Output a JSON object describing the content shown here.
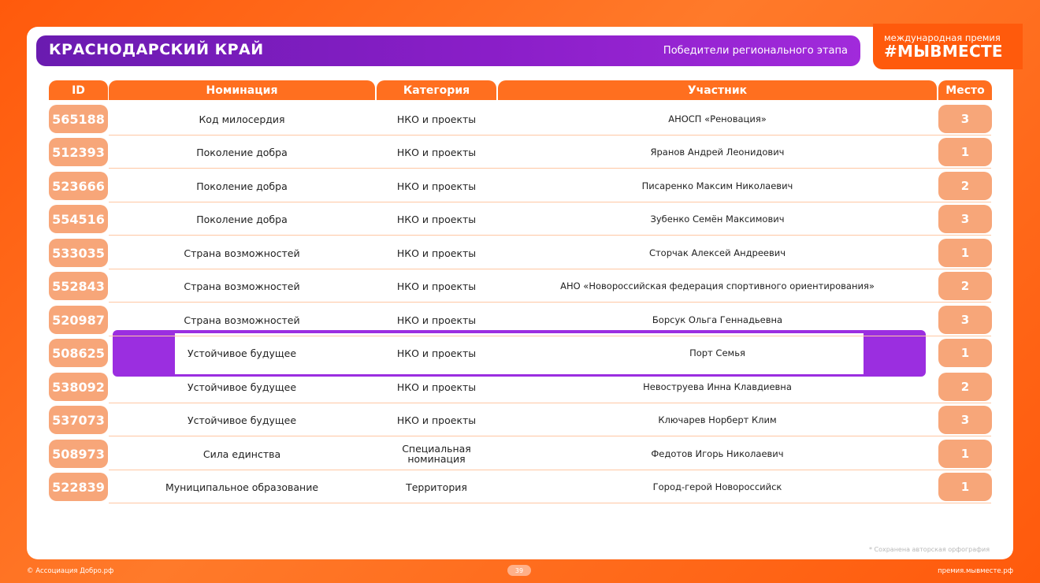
{
  "header": {
    "region": "КРАСНОДАРСКИЙ КРАЙ",
    "subtitle": "Победители регионального этапа",
    "award_small": "международная премия",
    "award_big": "#МЫВМЕСТЕ"
  },
  "columns": [
    "ID",
    "Номинация",
    "Категория",
    "Участник",
    "Место"
  ],
  "rows": [
    {
      "id": "565188",
      "nomination": "Код милосердия",
      "category": "НКО и проекты",
      "participant": "АНОСП «Реновация»",
      "place": "3"
    },
    {
      "id": "512393",
      "nomination": "Поколение добра",
      "category": "НКО и проекты",
      "participant": "Яранов Андрей Леонидович",
      "place": "1"
    },
    {
      "id": "523666",
      "nomination": "Поколение добра",
      "category": "НКО и проекты",
      "participant": "Писаренко Максим Николаевич",
      "place": "2"
    },
    {
      "id": "554516",
      "nomination": "Поколение добра",
      "category": "НКО и проекты",
      "participant": "Зубенко Семён Максимович",
      "place": "3"
    },
    {
      "id": "533035",
      "nomination": "Страна возможностей",
      "category": "НКО и проекты",
      "participant": "Сторчак Алексей Андреевич",
      "place": "1"
    },
    {
      "id": "552843",
      "nomination": "Страна возможностей",
      "category": "НКО и проекты",
      "participant": "АНО «Новороссийская федерация спортивного ориентирования»",
      "place": "2"
    },
    {
      "id": "520987",
      "nomination": "Страна возможностей",
      "category": "НКО и проекты",
      "participant": "Борсук Ольга Геннадьевна",
      "place": "3"
    },
    {
      "id": "508625",
      "nomination": "Устойчивое будущее",
      "category": "НКО и проекты",
      "participant": "Порт Семья",
      "place": "1"
    },
    {
      "id": "538092",
      "nomination": "Устойчивое будущее",
      "category": "НКО и проекты",
      "participant": "Невоструева Инна Клавдиевна",
      "place": "2"
    },
    {
      "id": "537073",
      "nomination": "Устойчивое будущее",
      "category": "НКО и проекты",
      "participant": "Ключарев Норберт Клим",
      "place": "3"
    },
    {
      "id": "508973",
      "nomination": "Сила единства",
      "category": "Специальная номинация",
      "participant": "Федотов Игорь Николаевич",
      "place": "1"
    },
    {
      "id": "522839",
      "nomination": "Муниципальное образование",
      "category": "Территория",
      "participant": "Город-герой Новороссийск",
      "place": "1"
    }
  ],
  "note": "* Сохранена авторская орфография",
  "footer": {
    "left": "© Ассоциация Добро.рф",
    "page": "39",
    "right": "премия.мывместе.рф"
  },
  "colors": {
    "brand_orange": "#ff5a0c",
    "header_purple": "#8a1ec8",
    "highlight_purple": "#9b2ee0",
    "pill_orange": "#f7a679"
  }
}
